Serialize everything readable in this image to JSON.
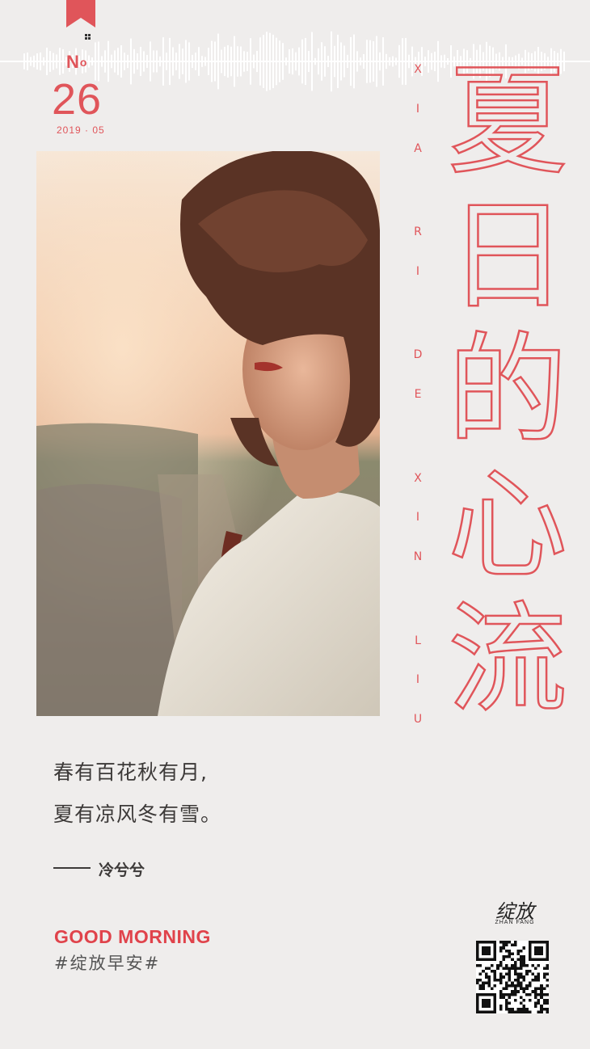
{
  "header": {
    "issue_label": "No",
    "issue_number": "26",
    "issue_date": "2019 · 05"
  },
  "title": {
    "chars": [
      "夏",
      "日",
      "的",
      "心",
      "流"
    ],
    "pinyin": [
      "X",
      "I",
      "A",
      "",
      "R",
      "I",
      "",
      "D",
      "E",
      "",
      "X",
      "I",
      "N",
      "",
      "L",
      "I",
      "U"
    ]
  },
  "quote": {
    "line1": "春有百花秋有月,",
    "line2": "夏有凉风冬有雪。",
    "author": "冷兮兮"
  },
  "footer": {
    "greeting": "GOOD MORNING",
    "tag": "#绽放早安#",
    "brand": "绽放",
    "brand_sub": "ZHAN FANG"
  },
  "colors": {
    "accent": "#e0555a",
    "background": "#efedec",
    "text": "#3d3a39"
  }
}
